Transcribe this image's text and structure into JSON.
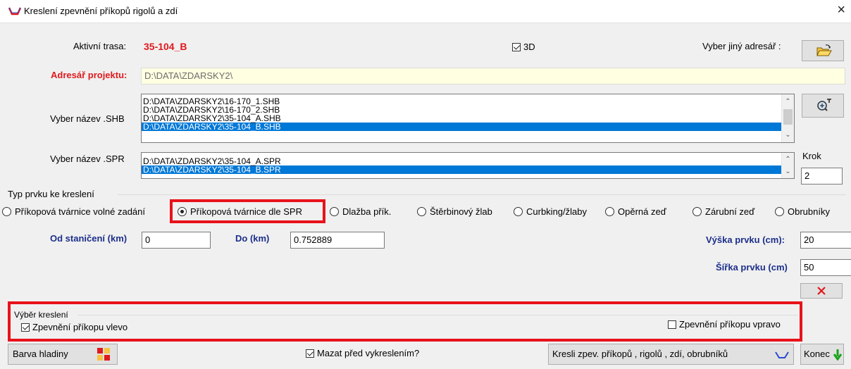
{
  "window": {
    "title": "Kreslení zpevnění příkopů rigolů a zdí",
    "close_glyph": "×"
  },
  "route": {
    "label": "Aktivní trasa:",
    "value": "35-104_B"
  },
  "check_3d": {
    "label": "3D",
    "checked": true
  },
  "choose_dir": {
    "label": "Vyber jiný adresář :"
  },
  "project_dir": {
    "label": "Adresář projektu:",
    "value": "D:\\DATA\\ZDARSKY2\\"
  },
  "shb": {
    "label": "Vyber název .SHB",
    "items": [
      "D:\\DATA\\ZDARSKY2\\16-170_1.SHB",
      "D:\\DATA\\ZDARSKY2\\16-170_2.SHB",
      "D:\\DATA\\ZDARSKY2\\35-104_A.SHB",
      "D:\\DATA\\ZDARSKY2\\35-104_B.SHB"
    ],
    "selected_index": 3
  },
  "spr": {
    "label": "Vyber název .SPR",
    "items": [
      "D:\\DATA\\ZDARSKY2\\35-104_A.SPR",
      "D:\\DATA\\ZDARSKY2\\35-104_B.SPR"
    ],
    "selected_index": 1
  },
  "step": {
    "label": "Krok",
    "value": "2"
  },
  "element_type": {
    "label": "Typ prvku ke kreslení",
    "options": [
      "Příkopová tvárnice volné zadání",
      "Příkopová tvárnice  dle SPR",
      "Dlažba přík.",
      "Štěrbinový žlab",
      "Curbking/žlaby",
      "Opěrná zeď",
      "Zárubní zeď",
      "Obrubníky"
    ],
    "selected_index": 1
  },
  "from_station": {
    "label": "Od staničení (km)",
    "value": "0"
  },
  "to_station": {
    "label": "Do (km)",
    "value": "0.752889"
  },
  "height": {
    "label": "Výška prvku (cm):",
    "value": "20"
  },
  "width": {
    "label": "Šířka prvku (cm)",
    "value": "50"
  },
  "draw_select": {
    "label": "Výběr kreslení",
    "left": {
      "label": "Zpevnění příkopu vlevo",
      "checked": true
    },
    "right": {
      "label": "Zpevnění příkopu vpravo",
      "checked": false
    }
  },
  "bottom": {
    "layer_color": "Barva hladiny",
    "erase_before": {
      "label": "Mazat před vykreslením?",
      "checked": true
    },
    "draw_button": "Kresli zpev. příkopů , rigolů , zdí, obrubníků",
    "end_button": "Konec"
  },
  "colors": {
    "accent_red": "#e0191d",
    "label_blue": "#1c2f8a",
    "selection": "#0078d7",
    "highlight_box": "#e8121b"
  }
}
